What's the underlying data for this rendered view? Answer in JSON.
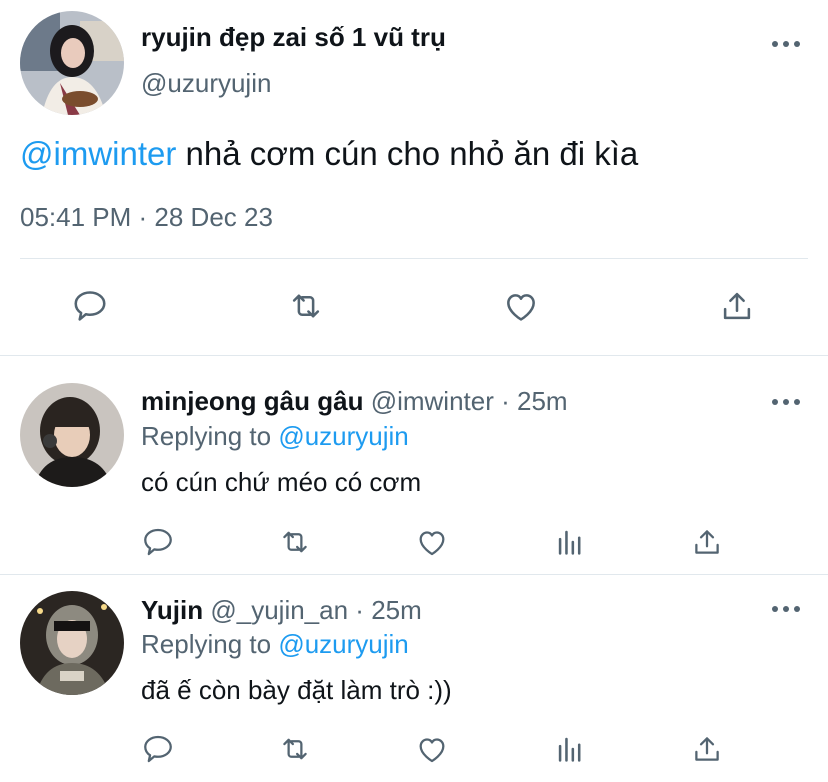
{
  "main_tweet": {
    "display_name": "ryujin đẹp zai số 1 vũ trụ",
    "handle": "@uzuryujin",
    "mention": "@imwinter",
    "text": " nhả cơm cún cho nhỏ ăn đi kìa",
    "timestamp": "05:41 PM · 28 Dec 23",
    "actions": [
      "reply-icon",
      "retweet-icon",
      "like-icon",
      "share-icon"
    ]
  },
  "replies": [
    {
      "display_name": "minjeong gâu gâu",
      "handle": "@imwinter",
      "separator": " · ",
      "time": "25m",
      "replying_prefix": "Replying to ",
      "replying_to": "@uzuryujin",
      "text": "có cún chứ méo có cơm",
      "actions": [
        "reply-icon",
        "retweet-icon",
        "like-icon",
        "views-icon",
        "share-icon"
      ]
    },
    {
      "display_name": "Yujin",
      "handle": "@_yujin_an",
      "separator": " · ",
      "time": "25m",
      "replying_prefix": "Replying to ",
      "replying_to": "@uzuryujin",
      "text": "đã ế còn bày đặt làm trò :))",
      "actions": [
        "reply-icon",
        "retweet-icon",
        "like-icon",
        "views-icon",
        "share-icon"
      ]
    }
  ],
  "colors": {
    "accent": "#1d9bf0",
    "text": "#0f1419",
    "secondary": "#536471",
    "divider": "#e1e8ed"
  }
}
